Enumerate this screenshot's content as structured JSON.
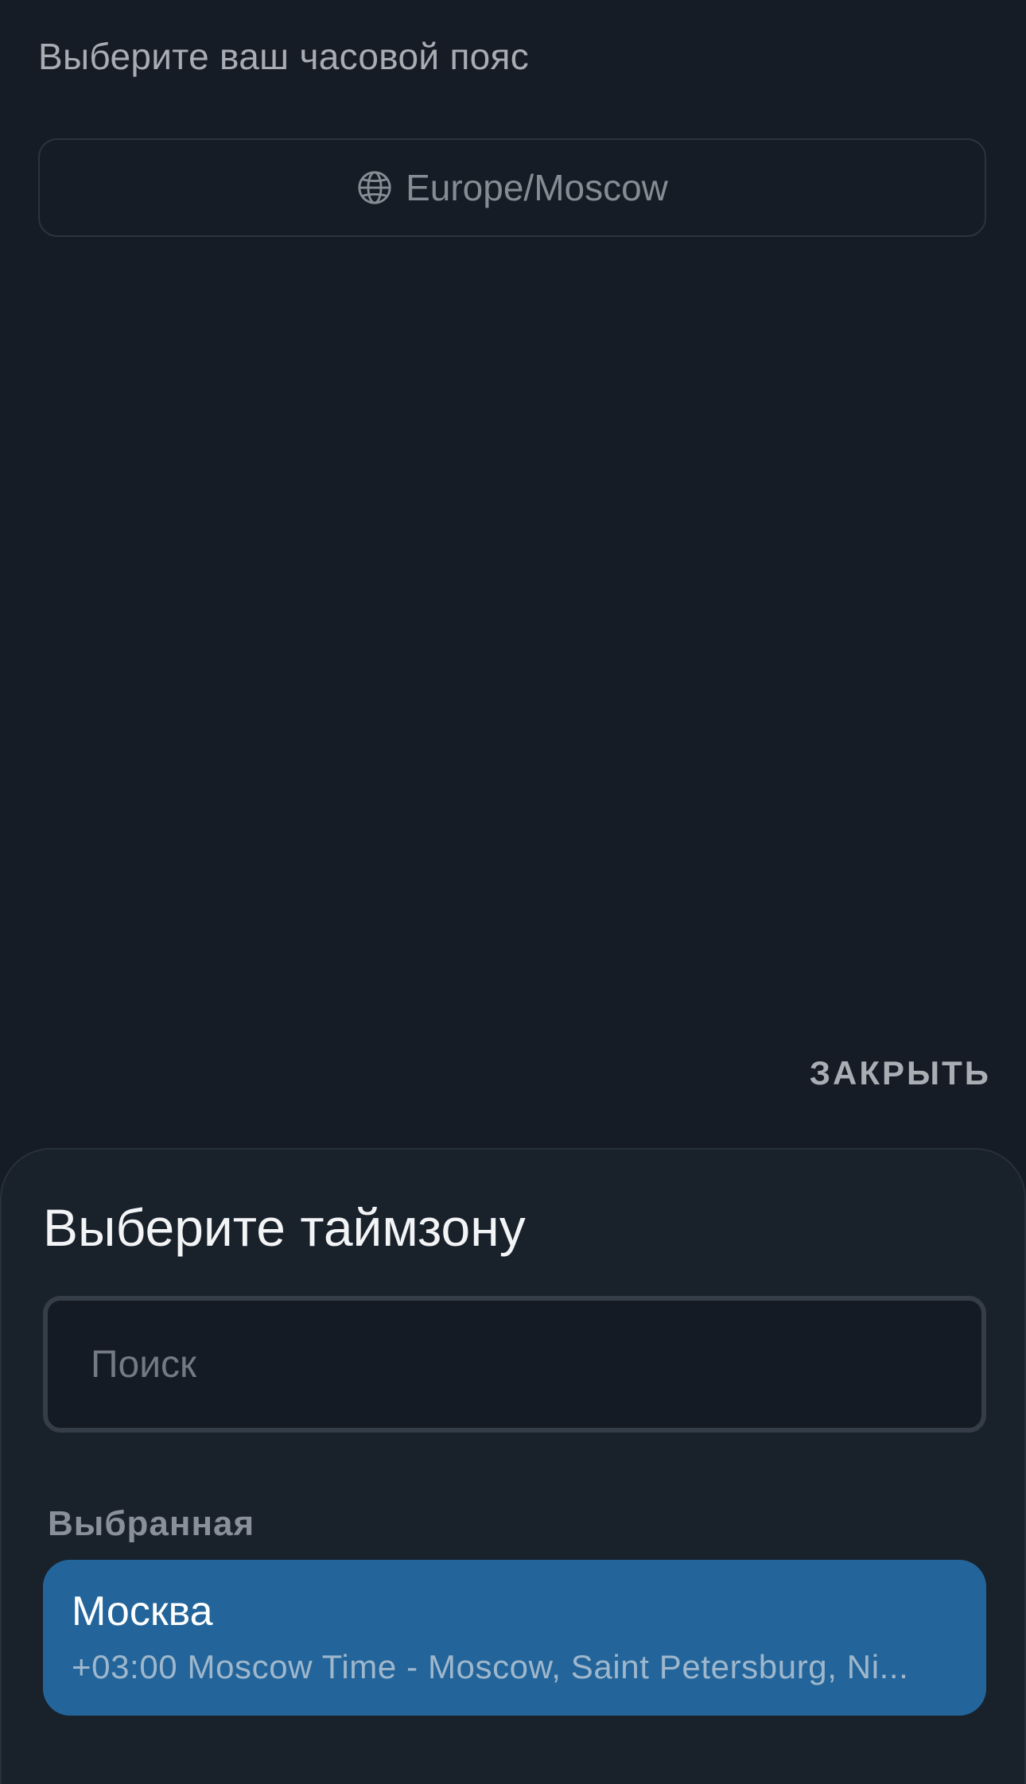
{
  "page": {
    "heading": "Выберите ваш часовой пояс",
    "timezone_button": {
      "icon": "globe-icon",
      "label": "Europe/Moscow"
    }
  },
  "sheet": {
    "close_label": "ЗАКРЫТЬ",
    "title": "Выберите таймзону",
    "search": {
      "placeholder": "Поиск",
      "value": ""
    },
    "selected_section_label": "Выбранная",
    "selected_item": {
      "name": "Москва",
      "description": "+03:00 Moscow Time - Moscow, Saint Petersburg, Ni..."
    }
  },
  "colors": {
    "background": "#161c25",
    "sheet_background": "#19212b",
    "selected_item_background": "#23659a",
    "accent_text": "#ffffff"
  }
}
